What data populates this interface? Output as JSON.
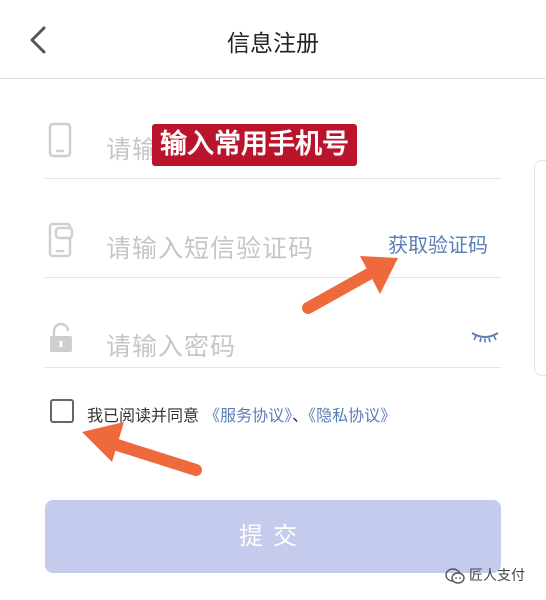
{
  "header": {
    "title": "信息注册"
  },
  "form": {
    "phone_placeholder": "请输",
    "phone_overlay": "输入常用手机号",
    "sms_placeholder": "请输入短信验证码",
    "get_code_label": "获取验证码",
    "password_placeholder": "请输入密码"
  },
  "agreement": {
    "prefix": "我已阅读并同意",
    "service_link": "《服务协议》",
    "separator": "、",
    "privacy_link": "《隐私协议》",
    "checked": false
  },
  "submit": {
    "label": "提交"
  },
  "watermark": {
    "text": "匠人支付"
  },
  "colors": {
    "link": "#5b7db6",
    "submit_bg": "#c5cbed",
    "overlay_bg": "#b9142b",
    "arrow": "#ee6a3c"
  },
  "icons": [
    "back-arrow-icon",
    "phone-icon",
    "sms-phone-icon",
    "lock-icon",
    "eye-closed-icon",
    "wechat-icon"
  ]
}
